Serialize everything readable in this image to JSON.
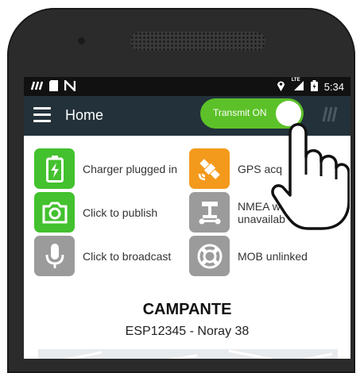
{
  "statusbar": {
    "time": "5:34",
    "lte_label": "LTE"
  },
  "appbar": {
    "title": "Home",
    "toggle_label": "Transmit ON"
  },
  "items": [
    {
      "label": "Charger plugged in",
      "color": "#43c12e",
      "icon": "battery-charging-icon"
    },
    {
      "label": "GPS acq",
      "color": "#f39a1c",
      "icon": "satellite-icon"
    },
    {
      "label": "Click to publish",
      "color": "#43c12e",
      "icon": "camera-icon"
    },
    {
      "label_line1": "NMEA w",
      "label_line2": "unavailab",
      "color": "#9b9b9b",
      "icon": "nmea-device-icon"
    },
    {
      "label": "Click to broadcast",
      "color": "#9b9b9b",
      "icon": "microphone-icon"
    },
    {
      "label": "MOB unlinked",
      "color": "#9b9b9b",
      "icon": "lifebuoy-icon"
    }
  ],
  "vessel": {
    "name": "CAMPANTE",
    "subtitle": "ESP12345 - Noray 38"
  },
  "colors": {
    "appbar": "#23313a",
    "toggle_on": "#5cc129",
    "accent_green": "#43c12e",
    "accent_orange": "#f39a1c",
    "inactive_gray": "#9b9b9b"
  }
}
